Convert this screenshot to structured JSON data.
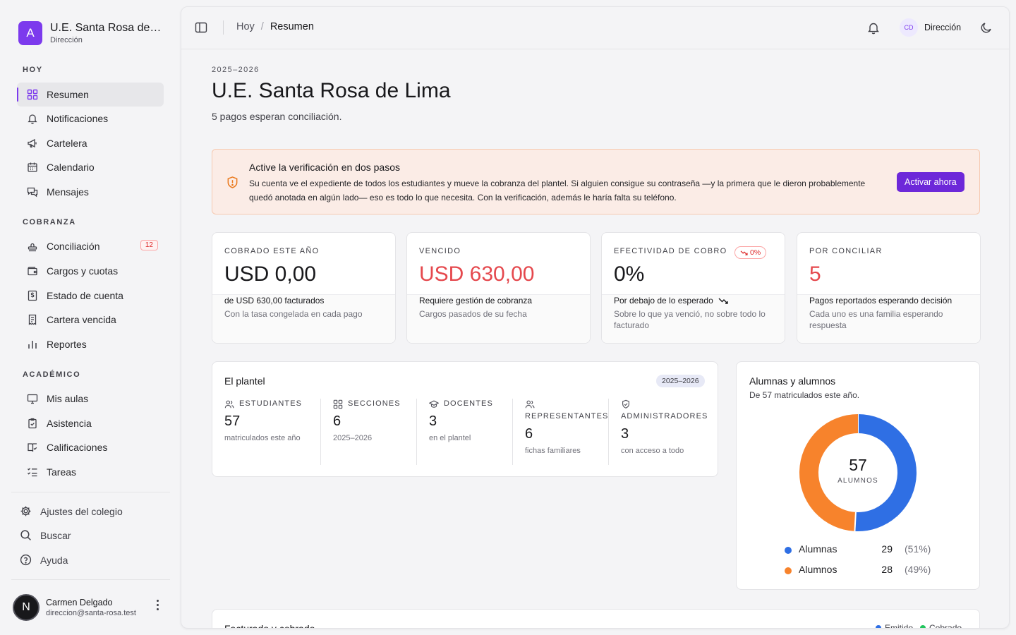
{
  "brand": {
    "logo_letter": "A",
    "name": "U.E. Santa Rosa de Lima",
    "role": "Dirección",
    "accent": "#7c3aed"
  },
  "nav": {
    "sections": [
      {
        "label": "HOY",
        "items": [
          {
            "label": "Resumen",
            "icon": "grid-icon",
            "active": true
          },
          {
            "label": "Notificaciones",
            "icon": "bell-icon"
          },
          {
            "label": "Cartelera",
            "icon": "megaphone-icon"
          },
          {
            "label": "Calendario",
            "icon": "calendar-icon"
          },
          {
            "label": "Mensajes",
            "icon": "messages-icon"
          }
        ]
      },
      {
        "label": "COBRANZA",
        "items": [
          {
            "label": "Conciliación",
            "icon": "stamp-icon",
            "badge": "12"
          },
          {
            "label": "Cargos y cuotas",
            "icon": "wallet-icon"
          },
          {
            "label": "Estado de cuenta",
            "icon": "receipt-dollar-icon"
          },
          {
            "label": "Cartera vencida",
            "icon": "receipt-overdue-icon"
          },
          {
            "label": "Reportes",
            "icon": "bar-chart-icon"
          }
        ]
      },
      {
        "label": "ACADÉMICO",
        "items": [
          {
            "label": "Mis aulas",
            "icon": "monitor-icon"
          },
          {
            "label": "Asistencia",
            "icon": "clipboard-check-icon"
          },
          {
            "label": "Calificaciones",
            "icon": "book-check-icon"
          },
          {
            "label": "Tareas",
            "icon": "list-checks-icon"
          }
        ]
      }
    ],
    "footer": [
      {
        "label": "Ajustes del colegio",
        "icon": "gear-icon"
      },
      {
        "label": "Buscar",
        "icon": "search-icon"
      },
      {
        "label": "Ayuda",
        "icon": "help-circle-icon"
      }
    ]
  },
  "user": {
    "initial": "N",
    "name": "Carmen Delgado",
    "email": "direccion@santa-rosa.test"
  },
  "topbar": {
    "breadcrumb_root": "Hoy",
    "breadcrumb_sep": "/",
    "breadcrumb_current": "Resumen",
    "user_initials": "CD",
    "user_role": "Dirección"
  },
  "header": {
    "year": "2025–2026",
    "title": "U.E. Santa Rosa de Lima",
    "subtitle": "5 pagos esperan conciliación."
  },
  "alert": {
    "title": "Active la verificación en dos pasos",
    "body": "Su cuenta ve el expediente de todos los estudiantes y mueve la cobranza del plantel. Si alguien consigue su contraseña —y la primera que le dieron probablemente quedó anotada en algún lado— eso es todo lo que necesita. Con la verificación, además le haría falta su teléfono.",
    "button": "Activar ahora"
  },
  "stats": [
    {
      "label": "COBRADO ESTE AÑO",
      "value": "USD 0,00",
      "sub": "de USD 630,00 facturados",
      "note": "Con la tasa congelada en cada pago",
      "tone": "default"
    },
    {
      "label": "VENCIDO",
      "value": "USD 630,00",
      "sub": "Requiere gestión de cobranza",
      "note": "Cargos pasados de su fecha",
      "tone": "red"
    },
    {
      "label": "EFECTIVIDAD DE COBRO",
      "value": "0%",
      "badge": "0%",
      "sub": "Por debajo de lo esperado",
      "note": "Sobre lo que ya venció, no sobre todo lo facturado",
      "tone": "default"
    },
    {
      "label": "POR CONCILIAR",
      "value": "5",
      "sub": "Pagos reportados esperando decisión",
      "note": "Cada uno es una familia esperando respuesta",
      "tone": "red"
    }
  ],
  "plantel": {
    "title": "El plantel",
    "pill": "2025–2026",
    "metrics": [
      {
        "label": "ESTUDIANTES",
        "icon": "users-icon",
        "value": "57",
        "note": "matriculados este año"
      },
      {
        "label": "SECCIONES",
        "icon": "grid-icon",
        "value": "6",
        "note": "2025–2026"
      },
      {
        "label": "DOCENTES",
        "icon": "graduation-cap-icon",
        "value": "3",
        "note": "en el plantel"
      },
      {
        "label": "REPRESENTANTES",
        "icon": "users-icon",
        "value": "6",
        "note": "fichas familiares"
      },
      {
        "label": "ADMINISTRADORES",
        "icon": "shield-check-icon",
        "value": "3",
        "note": "con acceso a todo"
      }
    ]
  },
  "gender": {
    "title": "Alumnas y alumnos",
    "subtitle": "De 57 matriculados este año.",
    "total": "57",
    "total_label": "ALUMNOS",
    "chart_data": {
      "type": "pie",
      "categories": [
        "Alumnas",
        "Alumnos"
      ],
      "values": [
        29,
        28
      ],
      "percent_labels": [
        "(51%)",
        "(49%)"
      ],
      "colors": [
        "#2f6fe4",
        "#f7832c"
      ]
    }
  },
  "facturado": {
    "title": "Facturado y cobrado",
    "legend": [
      {
        "label": "Emitido",
        "color": "#2f6fe4"
      },
      {
        "label": "Cobrado",
        "color": "#22c55e"
      }
    ]
  }
}
